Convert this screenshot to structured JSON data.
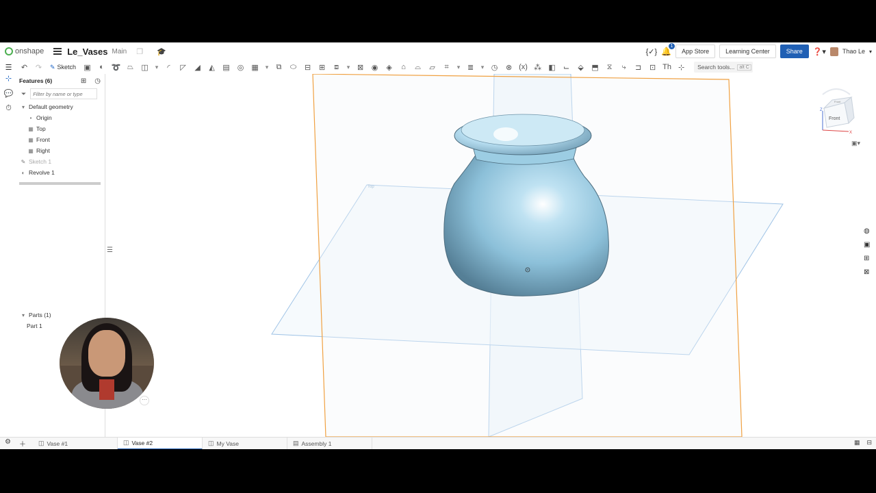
{
  "header": {
    "logo_text": "onshape",
    "doc_title": "Le_Vases",
    "branch": "Main",
    "buttons": {
      "app_store": "App Store",
      "learning_center": "Learning Center",
      "share": "Share"
    },
    "notification_count": "1",
    "user_name": "Thao Le"
  },
  "toolbar": {
    "sketch_label": "Sketch",
    "search_label": "Search tools...",
    "search_shortcut": "alt C"
  },
  "panel": {
    "features_title": "Features (6)",
    "filter_placeholder": "Filter by name or type",
    "default_geometry": "Default geometry",
    "items": [
      "Origin",
      "Top",
      "Front",
      "Right"
    ],
    "sketch": "Sketch 1",
    "revolve": "Revolve 1",
    "parts_title": "Parts (1)",
    "parts": [
      "Part 1"
    ]
  },
  "viewcube": {
    "front_label": "Front",
    "top_label": "Front",
    "z_axis": "Z",
    "x_axis": "X"
  },
  "viewport": {
    "plane_label_top": "Top"
  },
  "tabs": [
    "Vase #1",
    "Vase #2",
    "My Vase",
    "Assembly 1"
  ],
  "active_tab": "Vase #2",
  "colors": {
    "accent": "#1f5fb4",
    "plane_highlight": "#f0a040",
    "plane_edge": "#9fc3e6",
    "vase": "#8fc3dc"
  }
}
